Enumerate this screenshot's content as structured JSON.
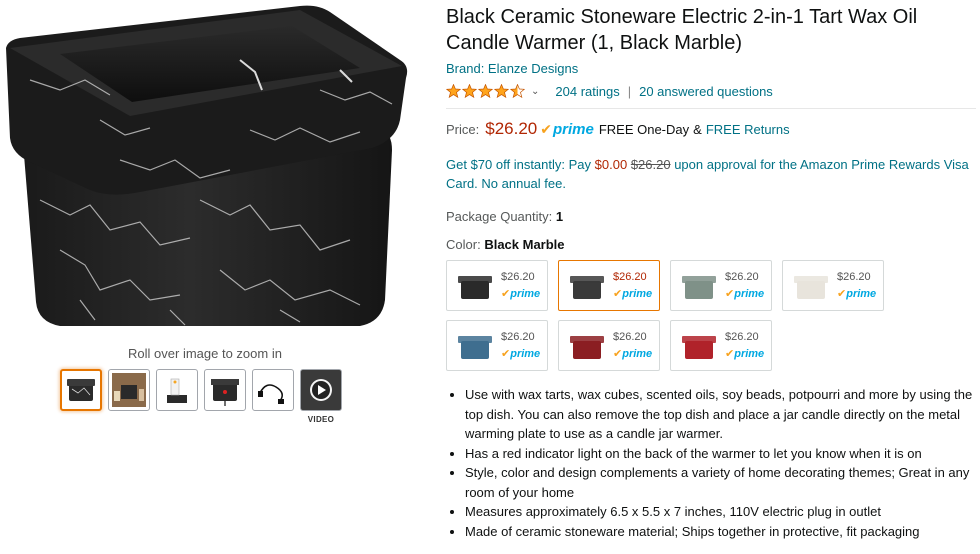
{
  "gallery": {
    "zoom_hint": "Roll over image to zoom in",
    "thumbnails": [
      {
        "name": "black-marble-warmer",
        "selected": true
      },
      {
        "name": "warmer-with-candles",
        "selected": false
      },
      {
        "name": "warmer-lit-candle",
        "selected": false
      },
      {
        "name": "warmer-back-view",
        "selected": false
      },
      {
        "name": "power-cord",
        "selected": false
      },
      {
        "name": "video",
        "selected": false
      }
    ],
    "video_label": "VIDEO"
  },
  "product": {
    "title": "Black Ceramic Stoneware Electric 2-in-1 Tart Wax Oil Candle Warmer (1, Black Marble)",
    "brand": "Brand: Elanze Designs",
    "rating_value": 4.5,
    "ratings_count": "204 ratings",
    "answered_questions": "20 answered questions",
    "price_label": "Price:",
    "price": "$26.20",
    "prime_label": "prime",
    "free_one_day": "FREE One-Day",
    "amp": "&",
    "free_returns": "FREE Returns",
    "promo": {
      "part1": "Get $70 off instantly: Pay",
      "pay_amount": "$0.00",
      "struck_amount": "$26.20",
      "part2": "upon approval for the Amazon Prime Rewards Visa Card. No annual fee."
    },
    "package_label": "Package Quantity:",
    "package_value": "1",
    "color_label": "Color:",
    "color_value": "Black Marble"
  },
  "swatches": [
    {
      "price": "$26.20",
      "prime": "prime",
      "color": "#2a2a2a",
      "selected": false
    },
    {
      "price": "$26.20",
      "prime": "prime",
      "color": "#3a3a3a",
      "selected": true
    },
    {
      "price": "$26.20",
      "prime": "prime",
      "color": "#7f9188",
      "selected": false
    },
    {
      "price": "$26.20",
      "prime": "prime",
      "color": "#e8e4dc",
      "selected": false
    },
    {
      "price": "$26.20",
      "prime": "prime",
      "color": "#3f6e8f",
      "selected": false
    },
    {
      "price": "$26.20",
      "prime": "prime",
      "color": "#8b1e22",
      "selected": false
    },
    {
      "price": "$26.20",
      "prime": "prime",
      "color": "#b0222a",
      "selected": false
    }
  ],
  "bullets": [
    "Use with wax tarts, wax cubes, scented oils, soy beads, potpourri and more by using the top dish. You can also remove the top dish and place a jar candle directly on the metal warming plate to use as a candle jar warmer.",
    "Has a red indicator light on the back of the warmer to let you know when it is on",
    "Style, color and design complements a variety of home decorating themes; Great in any room of your home",
    "Measures approximately 6.5 x 5.5 x 7 inches, 110V electric plug in outlet",
    "Made of ceramic stoneware material; Ships together in protective, fit packaging"
  ],
  "colors": {
    "price_red": "#b12704",
    "link": "#007185",
    "prime_blue": "#00a8e1",
    "star_orange": "#ffa41c",
    "selected_border": "#e77600"
  }
}
